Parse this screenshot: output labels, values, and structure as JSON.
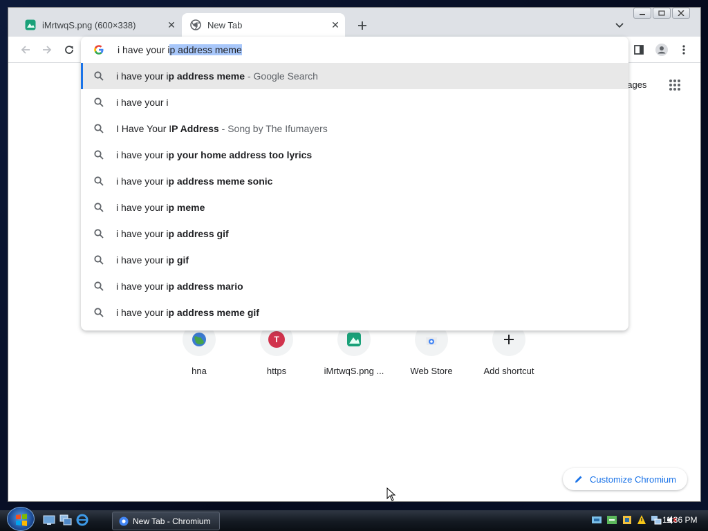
{
  "browser": {
    "tabs": [
      {
        "title": "iMrtwqS.png (600×338)",
        "active": false
      },
      {
        "title": "New Tab",
        "active": true
      }
    ]
  },
  "omnibox": {
    "typed": "i have your i",
    "selected": "p address meme",
    "suggestions": [
      {
        "plain": "i have your i",
        "bold": "p address meme",
        "desc": "- Google Search"
      },
      {
        "plain": "i have your i",
        "bold": "",
        "desc": ""
      },
      {
        "plain": "I Have Your I",
        "bold": "P Address",
        "desc": "- Song by The Ifumayers"
      },
      {
        "plain": "i have your i",
        "bold": "p your home address too lyrics",
        "desc": ""
      },
      {
        "plain": "i have your i",
        "bold": "p address meme sonic",
        "desc": ""
      },
      {
        "plain": "i have your i",
        "bold": "p meme",
        "desc": ""
      },
      {
        "plain": "i have your i",
        "bold": "p address gif",
        "desc": ""
      },
      {
        "plain": "i have your i",
        "bold": "p gif",
        "desc": ""
      },
      {
        "plain": "i have your i",
        "bold": "p address mario",
        "desc": ""
      },
      {
        "plain": "i have your i",
        "bold": "p address meme gif",
        "desc": ""
      }
    ]
  },
  "ntp": {
    "images_link": "nages",
    "shortcuts": [
      {
        "label": "hna",
        "icon": "globe-icon"
      },
      {
        "label": "https",
        "icon": "letter-t-icon",
        "letter": "T"
      },
      {
        "label": "iMrtwqS.png ...",
        "icon": "image-app-icon"
      },
      {
        "label": "Web Store",
        "icon": "web-store-icon"
      },
      {
        "label": "Add shortcut",
        "icon": "plus-icon"
      }
    ],
    "customize": "Customize Chromium"
  },
  "taskbar": {
    "task_label": "New Tab - Chromium",
    "clock": "11:36 PM"
  },
  "colors": {
    "accent": "#1a73e8",
    "tab_strip": "#dee1e6",
    "selection": "#a8c7fa",
    "t_avatar": "#d1334d"
  }
}
